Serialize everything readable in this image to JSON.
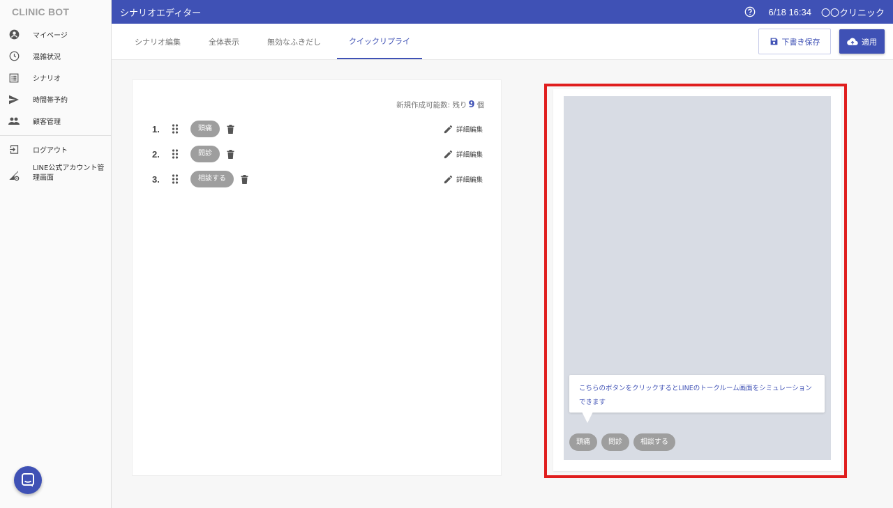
{
  "app": {
    "logo": "CLINIC BOT"
  },
  "sidebar": {
    "items": [
      {
        "label": "マイページ",
        "icon": "account-circle-icon"
      },
      {
        "label": "混雑状況",
        "icon": "clock-icon"
      },
      {
        "label": "シナリオ",
        "icon": "list-icon"
      },
      {
        "label": "時間帯予約",
        "icon": "send-icon"
      },
      {
        "label": "顧客管理",
        "icon": "people-icon"
      },
      {
        "label": "ログアウト",
        "icon": "logout-icon"
      },
      {
        "label": "LINE公式アカウント管理画面",
        "icon": "signal-settings-icon"
      }
    ]
  },
  "header": {
    "title": "シナリオエディター",
    "datetime": "6/18 16:34",
    "clinic": "〇〇クリニック"
  },
  "tabs": [
    {
      "label": "シナリオ編集",
      "active": false
    },
    {
      "label": "全体表示",
      "active": false
    },
    {
      "label": "無効なふきだし",
      "active": false
    },
    {
      "label": "クイックリプライ",
      "active": true
    }
  ],
  "actions": {
    "draft_label": "下書き保存",
    "apply_label": "適用"
  },
  "editor": {
    "remain_label": "新規作成可能数: 残り",
    "remain_count": "9",
    "remain_unit": "個",
    "edit_label": "詳細編集",
    "replies": [
      {
        "index": "1.",
        "label": "頭痛"
      },
      {
        "index": "2.",
        "label": "問診"
      },
      {
        "index": "3.",
        "label": "相談する"
      }
    ]
  },
  "preview": {
    "tooltip": "こちらのボタンをクリックするとLINEのトークルーム画面をシミュレーションできます",
    "chips": [
      "頭痛",
      "問診",
      "相談する"
    ]
  },
  "colors": {
    "primary": "#3f51b5",
    "highlight": "#e01e1e",
    "chip": "#9e9e9e",
    "preview_bg": "#d8dce4"
  }
}
